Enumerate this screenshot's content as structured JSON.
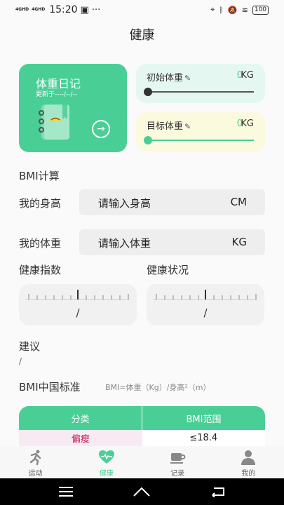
{
  "status": {
    "net1": "4GHD",
    "net2": "4GHD",
    "time": "15:20",
    "more": "···",
    "battery": "100"
  },
  "header": {
    "title": "健康"
  },
  "diary": {
    "title": "体重日记",
    "updated": "更新于----/--/--"
  },
  "initial_weight": {
    "label": "初始体重",
    "value": "0",
    "unit": "KG",
    "level": 0
  },
  "target_weight": {
    "label": "目标体重",
    "value": "0",
    "unit": "KG",
    "level": 0
  },
  "bmi_calc": {
    "title": "BMI计算",
    "height": {
      "label": "我的身高",
      "placeholder": "请输入身高",
      "unit": "CM"
    },
    "weight": {
      "label": "我的体重",
      "placeholder": "请输入体重",
      "unit": "KG"
    }
  },
  "indicators": {
    "index_label": "健康指数",
    "index_value": "/",
    "status_label": "健康状况",
    "status_value": "/"
  },
  "advice": {
    "label": "建议",
    "value": "/"
  },
  "bmi_standard": {
    "title": "BMI中国标准",
    "formula": "BMI=体重（Kg）/身高²（m）",
    "headers": [
      "分类",
      "BMI范围"
    ],
    "rows": [
      {
        "category": "偏瘦",
        "range": "≤18.4"
      }
    ]
  },
  "tabs": [
    {
      "label": "运动",
      "icon": "runner-icon"
    },
    {
      "label": "健康",
      "icon": "heart-pulse-icon"
    },
    {
      "label": "记录",
      "icon": "cup-icon"
    },
    {
      "label": "我的",
      "icon": "person-icon"
    }
  ],
  "colors": {
    "accent": "#49cf96",
    "initial_bg": "#e5f7f1",
    "target_bg": "#fbf9de",
    "underweight": "#c2185b"
  }
}
